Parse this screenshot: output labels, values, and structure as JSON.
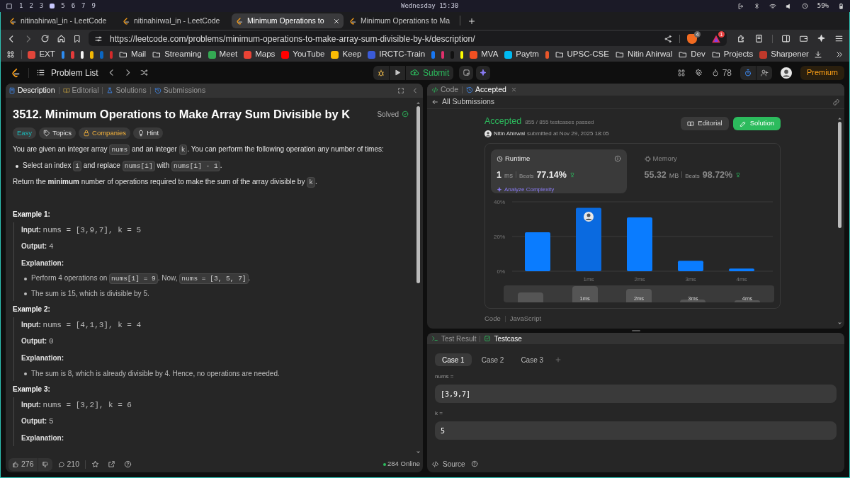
{
  "system_bar": {
    "workspaces": [
      {
        "label": "1",
        "selected": false
      },
      {
        "label": "2",
        "selected": false
      },
      {
        "label": "3",
        "selected": false
      },
      {
        "selected": true
      },
      {
        "label": "5",
        "selected": false
      },
      {
        "label": "6",
        "selected": false
      },
      {
        "label": "7",
        "selected": false
      },
      {
        "label": "9",
        "selected": false
      }
    ],
    "clock": "Wednesday 15:30",
    "battery": "59%"
  },
  "browser": {
    "tabs": [
      {
        "title": "nitinahirwal_in - LeetCode",
        "selected": false
      },
      {
        "title": "nitinahirwal_in - LeetCode",
        "selected": false
      },
      {
        "title": "Minimum Operations to",
        "selected": true
      },
      {
        "title": "Minimum Operations to Ma",
        "selected": false
      }
    ],
    "url": "https://leetcode.com/problems/minimum-operations-to-make-array-sum-divisible-by-k/description/",
    "shield_badge": "4",
    "rewards_badge": "1",
    "bookmarks": [
      {
        "kind": "site",
        "label": "EXT",
        "color": "#e0453a"
      },
      {
        "kind": "icon",
        "color": "#2d8cf0"
      },
      {
        "kind": "icon",
        "color": "#e23b3b"
      },
      {
        "kind": "icon",
        "color": "#f5f5f5"
      },
      {
        "kind": "icon",
        "color": "#f2b705"
      },
      {
        "kind": "icon",
        "color": "#0a66c2"
      },
      {
        "kind": "icon",
        "color": "#d42a2a"
      },
      {
        "kind": "folder",
        "label": "Mail"
      },
      {
        "kind": "folder",
        "label": "Streaming"
      },
      {
        "kind": "site",
        "label": "Meet",
        "color": "#34a853"
      },
      {
        "kind": "site",
        "label": "Maps",
        "color": "#ea4335"
      },
      {
        "kind": "site",
        "label": "YouTube",
        "color": "#ff0000"
      },
      {
        "kind": "site",
        "label": "Keep",
        "color": "#fbbc04"
      },
      {
        "kind": "site",
        "label": "IRCTC-Train",
        "color": "#3a5bd9"
      },
      {
        "kind": "icon",
        "color": "#1877f2"
      },
      {
        "kind": "icon",
        "color": "#e1306c"
      },
      {
        "kind": "icon",
        "color": "#111111"
      },
      {
        "kind": "icon",
        "color": "#fffc00"
      },
      {
        "kind": "site",
        "label": "MVA",
        "color": "#f25022"
      },
      {
        "kind": "site",
        "label": "Paytm",
        "color": "#00baf2"
      },
      {
        "kind": "icon",
        "color": "#e8562a"
      },
      {
        "kind": "folder",
        "label": "UPSC-CSE"
      },
      {
        "kind": "folder",
        "label": "Nitin Ahirwal"
      },
      {
        "kind": "folder",
        "label": "Dev"
      },
      {
        "kind": "folder",
        "label": "Projects"
      },
      {
        "kind": "site",
        "label": "Sharpener",
        "color": "#c0392b"
      }
    ]
  },
  "header": {
    "problem_list": "Problem List",
    "submit": "Submit",
    "streak": "78",
    "premium": "Premium"
  },
  "left_panel": {
    "tabs": [
      {
        "label": "Description",
        "selected": true
      },
      {
        "label": "Editorial",
        "selected": false
      },
      {
        "label": "Solutions",
        "selected": false
      },
      {
        "label": "Submissions",
        "selected": false
      }
    ],
    "title": "3512. Minimum Operations to Make Array Sum Divisible by K",
    "solved": "Solved",
    "tags": [
      {
        "kind": "difficulty",
        "label": "Easy"
      },
      {
        "kind": "topics",
        "label": "Topics"
      },
      {
        "kind": "companies",
        "label": "Companies"
      },
      {
        "kind": "hint",
        "label": "Hint"
      }
    ],
    "statement": [
      {
        "kind": "para",
        "segments": [
          {
            "text": "You are given an integer array "
          },
          {
            "code": "nums"
          },
          {
            "text": " and an integer "
          },
          {
            "code": "k"
          },
          {
            "text": ". You can perform the following operation any number of times:"
          }
        ]
      },
      {
        "kind": "bullet",
        "segments": [
          {
            "text": "Select an index "
          },
          {
            "code": "i"
          },
          {
            "text": " and replace "
          },
          {
            "code": "nums[i]"
          },
          {
            "text": " with "
          },
          {
            "code": "nums[i] - 1"
          },
          {
            "text": "."
          }
        ]
      },
      {
        "kind": "para",
        "segments": [
          {
            "text": "Return the **minimum** number of operations required to make the sum of the array divisible by "
          },
          {
            "code": "k"
          },
          {
            "text": "."
          }
        ]
      }
    ],
    "examples": [
      {
        "title": "Example 1:",
        "input_label": "Input:",
        "input": "nums = [3,9,7], k = 5",
        "output_label": "Output:",
        "output": "4",
        "explanation_label": "Explanation:",
        "bullets": [
          [
            {
              "text": "Perform 4 operations on "
            },
            {
              "code": "nums[1] = 9"
            },
            {
              "text": ". Now, "
            },
            {
              "code": "nums = [3, 5, 7]"
            },
            {
              "text": "."
            }
          ],
          [
            {
              "text": "The sum is 15, which is divisible by 5."
            }
          ]
        ]
      },
      {
        "title": "Example 2:",
        "input_label": "Input:",
        "input": "nums = [4,1,3], k = 4",
        "output_label": "Output:",
        "output": "0",
        "explanation_label": "Explanation:",
        "bullets": [
          [
            {
              "text": "The sum is 8, which is already divisible by 4. Hence, no operations are needed."
            }
          ]
        ]
      },
      {
        "title": "Example 3:",
        "input_label": "Input:",
        "input": "nums = [3,2], k = 6",
        "output_label": "Output:",
        "output": "5",
        "explanation_label": "Explanation:"
      }
    ],
    "footer": {
      "likes": "276",
      "comments": "210",
      "online": "284 Online"
    }
  },
  "right_panel": {
    "tabs": [
      {
        "label": "Code",
        "selected": false
      },
      {
        "label": "Accepted",
        "selected": true
      }
    ],
    "back_label": "All Submissions",
    "submission": {
      "status": "Accepted",
      "testcases": "855 / 855 testcases passed",
      "user": "Nitin Ahirwal",
      "submitted": "submitted at Nov 29, 2025 18:05",
      "editorial_button": "Editorial",
      "solution_button": "Solution",
      "metrics": [
        {
          "label": "Runtime",
          "value": "1",
          "unit": "ms",
          "beats_label": "Beats",
          "beats": "77.14%",
          "selected": true
        },
        {
          "label": "Memory",
          "value": "55.32",
          "unit": "MB",
          "beats_label": "Beats",
          "beats": "98.72%",
          "selected": false
        }
      ],
      "analyze": "Analyze Complexity",
      "chart_data": {
        "type": "bar",
        "categories": [
          null,
          "1ms",
          "2ms",
          "3ms",
          "4ms"
        ],
        "values": [
          22.5,
          36.5,
          31,
          6,
          1.5
        ],
        "ylim": [
          0,
          40
        ],
        "yticks": [
          {
            "value": 0,
            "label": "0%"
          },
          {
            "value": 20,
            "label": "20%"
          },
          {
            "value": 40,
            "label": "40%"
          }
        ]
      },
      "overview_labels": [
        "1ms",
        "2ms",
        "3ms",
        "4ms"
      ],
      "code_label": "Code",
      "language": "JavaScript"
    }
  },
  "test_panel": {
    "tabs": [
      {
        "label": "Test Result",
        "selected": false
      },
      {
        "label": "Testcase",
        "selected": true
      }
    ],
    "cases": [
      {
        "label": "Case 1",
        "selected": true
      },
      {
        "label": "Case 2",
        "selected": false
      },
      {
        "label": "Case 3",
        "selected": false
      }
    ],
    "params": [
      {
        "label": "nums =",
        "value": "[3,9,7]"
      },
      {
        "label": "k =",
        "value": "5"
      }
    ],
    "source": "Source"
  }
}
